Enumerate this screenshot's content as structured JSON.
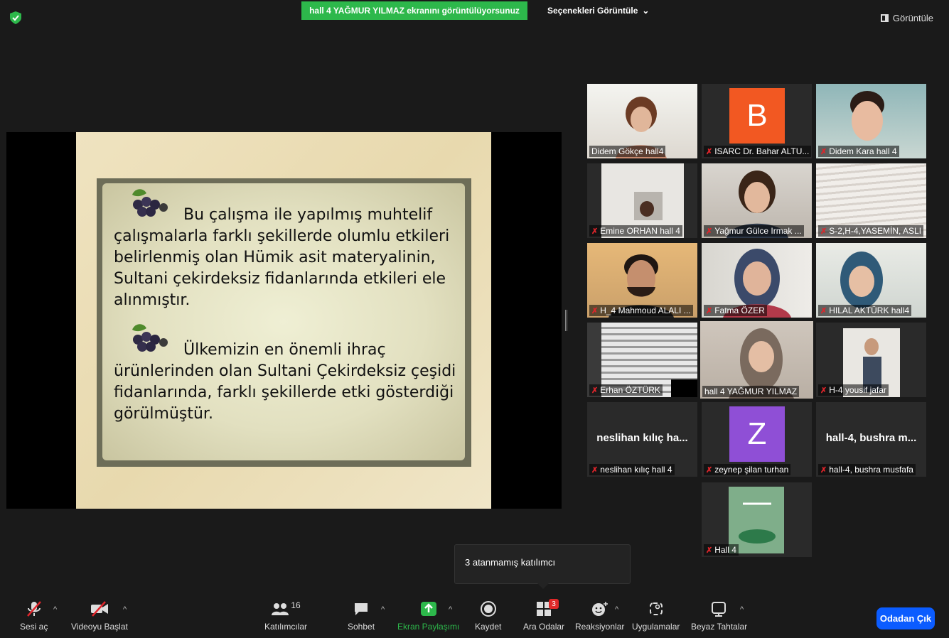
{
  "topbar": {
    "share_banner": "hall 4 YAĞMUR YILMAZ ekranını görüntülüyorsunuz",
    "view_options": "Seçenekleri Görüntüle",
    "view_button": "Görüntüle"
  },
  "slide": {
    "bullet1": [
      "Bu çalışma ile yapılmış muhtelif",
      "çalışmalarla farklı şekillerde olumlu etkileri",
      "belirlenmiş olan Hümik asit materyalinin,",
      "Sultani çekirdeksiz fidanlarında etkileri ele",
      "alınmıştır."
    ],
    "bullet2": [
      "Ülkemizin en önemli ihraç",
      "ürünlerinden olan Sultani Çekirdeksiz çeşidi",
      "fidanlarında, farklı şekillerde etki gösterdiği",
      "görülmüştür."
    ]
  },
  "participants": [
    {
      "name": "Didem Gökçe hall4",
      "muted": false
    },
    {
      "name": "ISARC Dr. Bahar ALTU...",
      "muted": true,
      "avatar_letter": "B",
      "avatar_color": "#f25822"
    },
    {
      "name": "Didem Kara hall 4",
      "muted": true
    },
    {
      "name": "Emine ORHAN hall 4",
      "muted": true
    },
    {
      "name": "Yağmur Gülce Irmak ...",
      "muted": true
    },
    {
      "name": "S-2,H-4,YASEMİN, ASLI",
      "muted": true
    },
    {
      "name": "H_4 Mahmoud ALALI ...",
      "muted": true
    },
    {
      "name": "Fatma ÖZER",
      "muted": true
    },
    {
      "name": "HILAL AKTÜRK hall4",
      "muted": true
    },
    {
      "name": "Erhan ÖZTÜRK",
      "muted": true
    },
    {
      "name": "hall 4 YAĞMUR YILMAZ",
      "muted": false,
      "active": true
    },
    {
      "name": "H-4 yousif jafar",
      "muted": true
    },
    {
      "name": "neslihan kılıç hall 4",
      "muted": true,
      "big_name": "neslihan kılıç ha..."
    },
    {
      "name": "zeynep şilan turhan",
      "muted": true,
      "avatar_letter": "Z",
      "avatar_color": "#8f4fd6"
    },
    {
      "name": "hall-4, bushra musfafa",
      "muted": true,
      "big_name": "hall-4, bushra m..."
    },
    {
      "name": "Hall 4",
      "muted": true
    }
  ],
  "tooltip": "3 atanmamış katılımcı",
  "toolbar": {
    "audio": "Sesi aç",
    "video": "Videoyu Başlat",
    "participants": "Katılımcılar",
    "participants_count": "16",
    "chat": "Sohbet",
    "share": "Ekran Paylaşımı",
    "record": "Kaydet",
    "breakout": "Ara Odalar",
    "breakout_badge": "3",
    "reactions": "Reaksiyonlar",
    "apps": "Uygulamalar",
    "whiteboard": "Beyaz Tahtalar",
    "leave": "Odadan Çık"
  }
}
